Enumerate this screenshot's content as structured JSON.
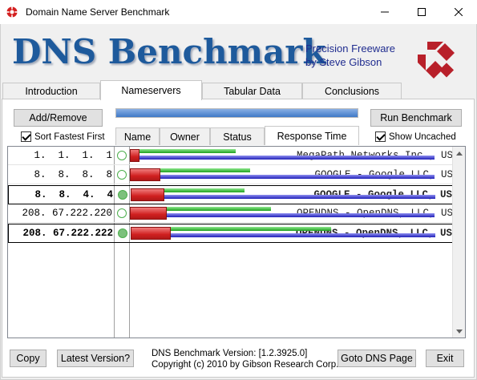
{
  "window": {
    "title": "Domain Name Server Benchmark"
  },
  "banner": {
    "logo": "DNS Benchmark",
    "tagline_line1": "Precision Freeware",
    "tagline_line2": "by Steve Gibson",
    "logo_color": "#1e5a9c",
    "brand_color": "#b8202a"
  },
  "tabs": [
    {
      "label": "Introduction",
      "active": false
    },
    {
      "label": "Nameservers",
      "active": true
    },
    {
      "label": "Tabular Data",
      "active": false
    },
    {
      "label": "Conclusions",
      "active": false
    }
  ],
  "toolbar": {
    "add_remove": "Add/Remove",
    "run_benchmark": "Run Benchmark",
    "sort_fastest": "Sort Fastest First",
    "show_uncached": "Show Uncached",
    "progress": 1.0
  },
  "columns": [
    "Name",
    "Owner",
    "Status",
    "Response Time"
  ],
  "rows": [
    {
      "ip": " 1.  1.  1.  1",
      "owner": "MegaPath Networks Inc., US",
      "bold": false,
      "selected": false,
      "status_color": "#ffffff",
      "red": 12,
      "green": 120,
      "blue": 200
    },
    {
      "ip": " 8.  8.  8.  8",
      "owner": "GOOGLE - Google LLC, US",
      "bold": false,
      "selected": false,
      "status_color": "#ffffff",
      "red": 38,
      "green": 112,
      "blue": 200
    },
    {
      "ip": " 8.  8.  4.  4",
      "owner": "GOOGLE - Google LLC, US",
      "bold": true,
      "selected": true,
      "status_color": "#7cc17c",
      "red": 42,
      "green": 100,
      "blue": 200
    },
    {
      "ip": "208. 67.222.220",
      "owner": "OPENDNS - OpenDNS, LLC, US",
      "bold": false,
      "selected": false,
      "status_color": "#ffffff",
      "red": 46,
      "green": 130,
      "blue": 200
    },
    {
      "ip": "208. 67.222.222",
      "owner": "OPENDNS - OpenDNS, LLC, US",
      "bold": true,
      "selected": true,
      "status_color": "#7cc17c",
      "red": 50,
      "green": 200,
      "blue": 200
    }
  ],
  "footer": {
    "copy": "Copy",
    "latest_version": "Latest Version?",
    "version_text": "DNS Benchmark Version: [1.2.3925.0]",
    "copyright_text": "Copyright (c) 2010 by Gibson Research Corp.",
    "goto_dns": "Goto DNS Page",
    "exit": "Exit"
  }
}
